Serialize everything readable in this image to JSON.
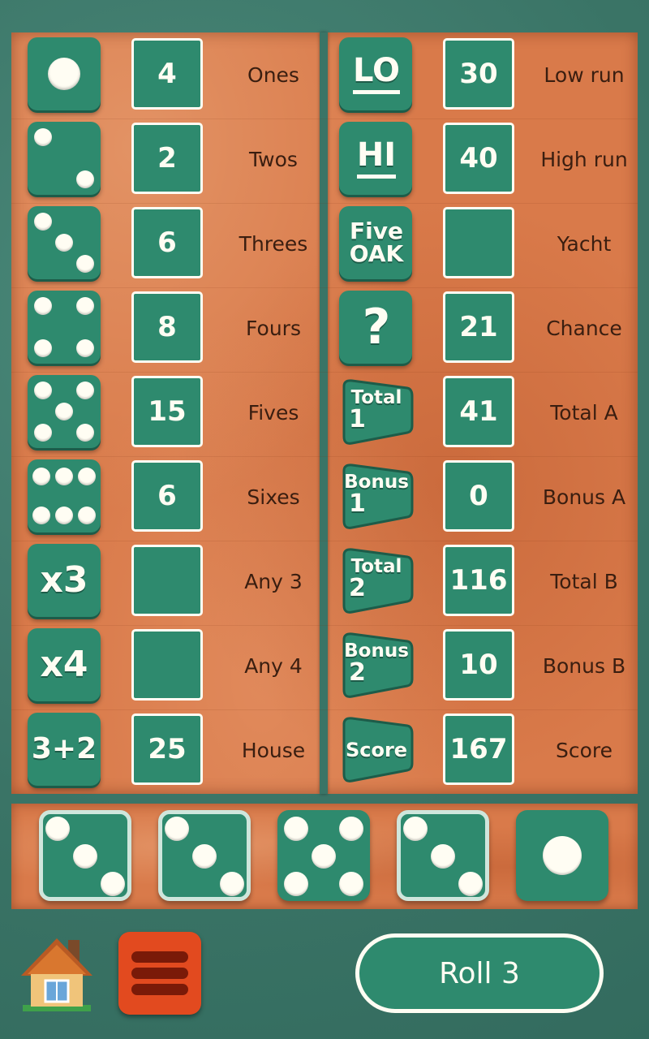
{
  "left_rows": [
    {
      "label": "Ones",
      "value": "4",
      "icon": "die-one-icon"
    },
    {
      "label": "Twos",
      "value": "2",
      "icon": "die-two-icon"
    },
    {
      "label": "Threes",
      "value": "6",
      "icon": "die-three-icon"
    },
    {
      "label": "Fours",
      "value": "8",
      "icon": "die-four-icon"
    },
    {
      "label": "Fives",
      "value": "15",
      "icon": "die-five-icon"
    },
    {
      "label": "Sixes",
      "value": "6",
      "icon": "die-six-icon"
    },
    {
      "label": "Any 3",
      "value": "",
      "icon_text": "x3"
    },
    {
      "label": "Any 4",
      "value": "",
      "icon_text": "x4"
    },
    {
      "label": "House",
      "value": "25",
      "icon_text": "3+2"
    }
  ],
  "right_rows": [
    {
      "label": "Low run",
      "value": "30",
      "icon_text": "LO"
    },
    {
      "label": "High run",
      "value": "40",
      "icon_text": "HI"
    },
    {
      "label": "Yacht",
      "value": "",
      "icon_text_1": "Five",
      "icon_text_2": "OAK"
    },
    {
      "label": "Chance",
      "value": "21",
      "icon_text": "?"
    },
    {
      "label": "Total A",
      "value": "41",
      "icon_text_1": "Total",
      "icon_text_2": "1"
    },
    {
      "label": "Bonus A",
      "value": "0",
      "icon_text_1": "Bonus",
      "icon_text_2": "1"
    },
    {
      "label": "Total B",
      "value": "116",
      "icon_text_1": "Total",
      "icon_text_2": "2"
    },
    {
      "label": "Bonus B",
      "value": "10",
      "icon_text_1": "Bonus",
      "icon_text_2": "2"
    },
    {
      "label": "Score",
      "value": "167",
      "icon_text": "Score"
    }
  ],
  "dice": [
    {
      "face": 3,
      "held": true
    },
    {
      "face": 3,
      "held": true
    },
    {
      "face": 5,
      "held": false
    },
    {
      "face": 3,
      "held": true
    },
    {
      "face": 1,
      "held": false
    }
  ],
  "controls": {
    "roll_label": "Roll 3"
  },
  "colors": {
    "tile": "#2e8a6e",
    "board": "#d97a4a",
    "menu": "#e24a1f",
    "frame": "#3f7d6f"
  }
}
